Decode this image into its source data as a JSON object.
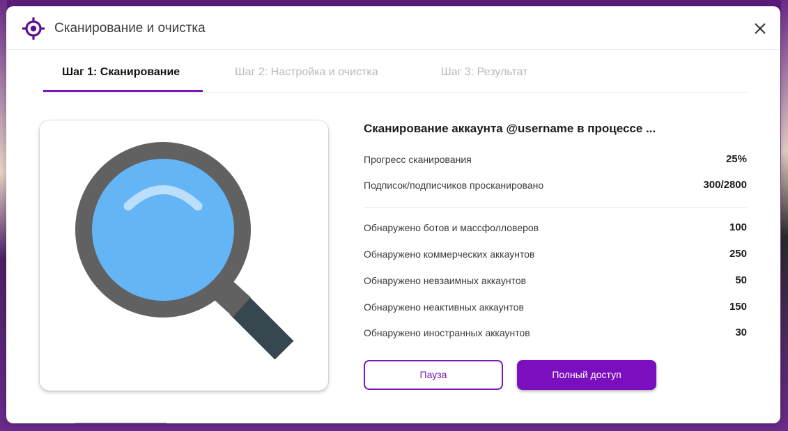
{
  "header": {
    "title": "Сканирование и очистка",
    "icon": "crosshair-target-icon",
    "close_icon": "close-icon"
  },
  "tabs": [
    {
      "label": "Шаг 1: Сканирование",
      "active": true
    },
    {
      "label": "Шаг 2: Настройка и очистка",
      "active": false
    },
    {
      "label": "Шаг 3: Результат",
      "active": false
    }
  ],
  "illustration": {
    "icon": "magnifier-icon"
  },
  "scan": {
    "title": "Сканирование аккаунта @username в процессе ...",
    "progress": {
      "label": "Прогресс сканирования",
      "value": "25%"
    },
    "scanned": {
      "label": "Подписок/подписчиков просканировано",
      "value": "300/2800"
    },
    "stats": [
      {
        "label": "Обнаружено ботов и массфолловеров",
        "value": "100"
      },
      {
        "label": "Обнаружено коммерческих аккаунтов",
        "value": "250"
      },
      {
        "label": "Обнаружено невзаимных аккаунтов",
        "value": "50"
      },
      {
        "label": "Обнаружено неактивных аккаунтов",
        "value": "150"
      },
      {
        "label": "Обнаружено иностранных аккаунтов",
        "value": "30"
      }
    ]
  },
  "actions": {
    "pause_label": "Пауза",
    "full_access_label": "Полный доступ"
  },
  "colors": {
    "accent": "#7b16b8",
    "lens": "#64b5f6",
    "frame": "#616161",
    "handle": "#37474f"
  }
}
